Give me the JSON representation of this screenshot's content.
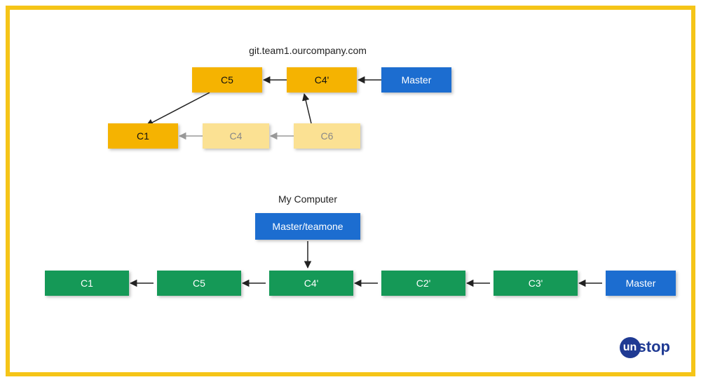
{
  "titles": {
    "remote": "git.team1.ourcompany.com",
    "local": "My Computer"
  },
  "remote": {
    "c5": "C5",
    "c4p": "C4'",
    "master": "Master",
    "c1": "C1",
    "c4": "C4",
    "c6": "C6"
  },
  "local": {
    "ref": "Master/teamone",
    "c1": "C1",
    "c5": "C5",
    "c4p": "C4'",
    "c2p": "C2'",
    "c3p": "C3'",
    "master": "Master"
  },
  "logo": {
    "prefix": "un",
    "rest": "stop"
  },
  "colors": {
    "orange": "#f5b301",
    "orange_light": "#fbe193",
    "blue": "#1c6dd0",
    "green": "#159957",
    "frame": "#f5c518"
  }
}
